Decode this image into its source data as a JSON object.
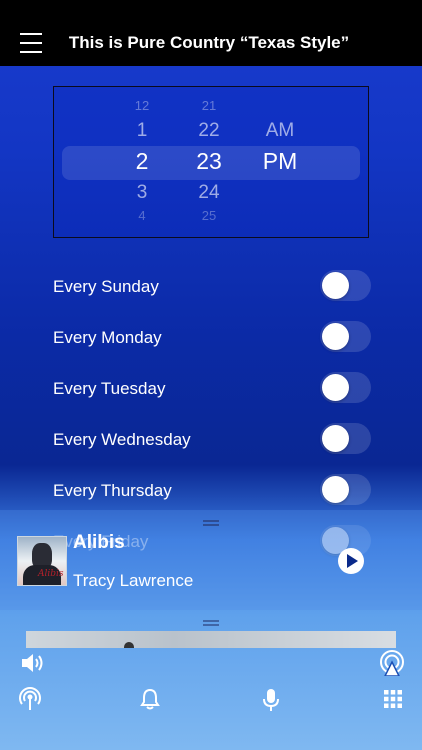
{
  "header": {
    "title": "This is Pure Country “Texas Style”"
  },
  "time_picker": {
    "hours": [
      "12",
      "1",
      "2",
      "3",
      "4"
    ],
    "minutes": [
      "21",
      "22",
      "23",
      "24",
      "25"
    ],
    "ampm": [
      "",
      "AM",
      "PM",
      "",
      ""
    ],
    "selected": {
      "hour": "2",
      "minute": "23",
      "ampm": "PM"
    }
  },
  "schedule": {
    "days": [
      {
        "label": "Every Sunday",
        "enabled": false
      },
      {
        "label": "Every Monday",
        "enabled": false
      },
      {
        "label": "Every Tuesday",
        "enabled": false
      },
      {
        "label": "Every Wednesday",
        "enabled": false
      },
      {
        "label": "Every Thursday",
        "enabled": false
      },
      {
        "label": "Every Friday",
        "enabled": false
      }
    ]
  },
  "now_playing": {
    "title": "Alibis",
    "artist": "Tracy Lawrence",
    "album_art_lettering": "Tracy Lawrence Alibis"
  },
  "bottom_bar": {
    "icons": [
      "volume-icon",
      "airplay-icon",
      "broadcast-icon",
      "bell-icon",
      "microphone-icon",
      "grid-icon"
    ]
  },
  "colors": {
    "header_bg": "#000000",
    "bg_top": "#1a3ccf",
    "bg_bottom": "#7fb8f1"
  }
}
